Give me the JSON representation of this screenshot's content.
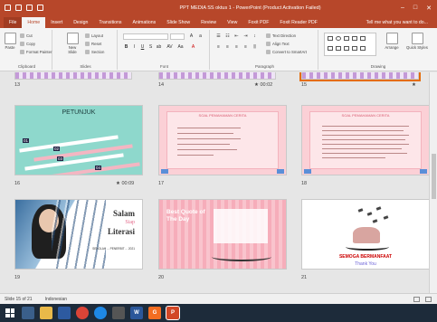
{
  "window": {
    "title": "PPT MEDIA SS oktus 1 - PowerPoint (Product Activation Failed)"
  },
  "tabs": [
    "File",
    "Home",
    "Insert",
    "Design",
    "Transitions",
    "Animations",
    "Slide Show",
    "Review",
    "View",
    "Foxit PDF",
    "Foxit Reader PDF"
  ],
  "tell_me": "Tell me what you want to do...",
  "ribbon": {
    "clipboard": {
      "label": "Clipboard",
      "paste": "Paste",
      "cut": "Cut",
      "copy": "Copy",
      "format_painter": "Format Painter"
    },
    "slides": {
      "label": "Slides",
      "new_slide": "New Slide",
      "layout": "Layout",
      "reset": "Reset",
      "section": "Section"
    },
    "font": {
      "label": "Font"
    },
    "paragraph": {
      "label": "Paragraph",
      "text_direction": "Text Direction",
      "align_text": "Align Text",
      "convert_smartart": "Convert to SmartArt"
    },
    "drawing": {
      "label": "Drawing",
      "arrange": "Arrange",
      "quick_styles": "Quick Styles"
    }
  },
  "slides": [
    {
      "number": "13"
    },
    {
      "number": "14",
      "time": "00:02"
    },
    {
      "number": "15"
    },
    {
      "number": "16",
      "time": "00:09",
      "title": "PETUNJUK",
      "steps": [
        "01",
        "02",
        "03",
        "04"
      ]
    },
    {
      "number": "17",
      "heading": "SOAL PEMAHAMAN CERITA"
    },
    {
      "number": "18",
      "heading": "SOAL PEMAHAMAN CERITA"
    },
    {
      "number": "19",
      "line1": "Salam",
      "line2": "Siap",
      "line3": "Literasi",
      "sub": "SEKOLAH ... PENERBIT ... 2021"
    },
    {
      "number": "20",
      "quote": "Best Quote of The Day"
    },
    {
      "number": "21",
      "line1": "SEMOGA BERMANFAAT",
      "line2": "Thank You"
    }
  ],
  "status": {
    "slide_info": "Slide 15 of 21",
    "language": "Indonesian"
  },
  "colors": {
    "accent": "#b7472a",
    "selection": "#e46c0a",
    "pink": "#fbd0d6",
    "teal": "#8ed8cc"
  }
}
